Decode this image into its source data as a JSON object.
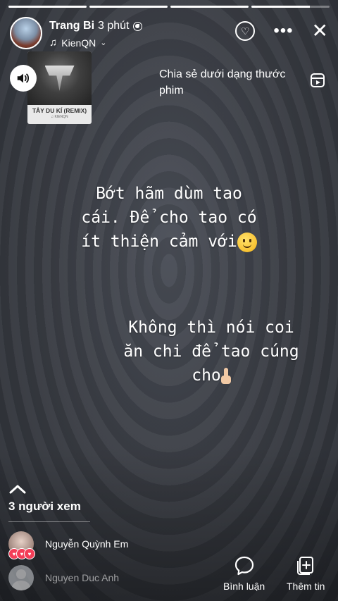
{
  "story": {
    "progress": [
      1,
      1,
      1,
      0.75
    ]
  },
  "header": {
    "username": "Trang Bi",
    "time": "3 phút",
    "music_artist": "KienQN"
  },
  "album": {
    "title": "TÂY DU KÍ (REMIX)",
    "artist": "♫ KIENQN"
  },
  "share": {
    "label": "Chia sẻ dưới dạng thước phim"
  },
  "captions": {
    "line1": "Bớt hãm dùm tao\ncái. Để cho tao có\nít thiện cảm với",
    "line2": "Không thì nói coi\năn chi để tao cúng\ncho"
  },
  "viewers": {
    "count_label": "3 người xem",
    "list": [
      {
        "name": "Nguyễn Quỳnh Em"
      },
      {
        "name": "Nguyen Duc Anh"
      }
    ]
  },
  "actions": {
    "comment_label": "Bình luận",
    "add_story_label": "Thêm tin"
  },
  "icons": [
    "globe-icon",
    "music-note-icon",
    "chevron-down-icon",
    "heart-icon",
    "more-icon",
    "close-icon",
    "speaker-icon",
    "reel-icon",
    "chevron-up-icon",
    "comment-icon",
    "add-story-icon"
  ]
}
